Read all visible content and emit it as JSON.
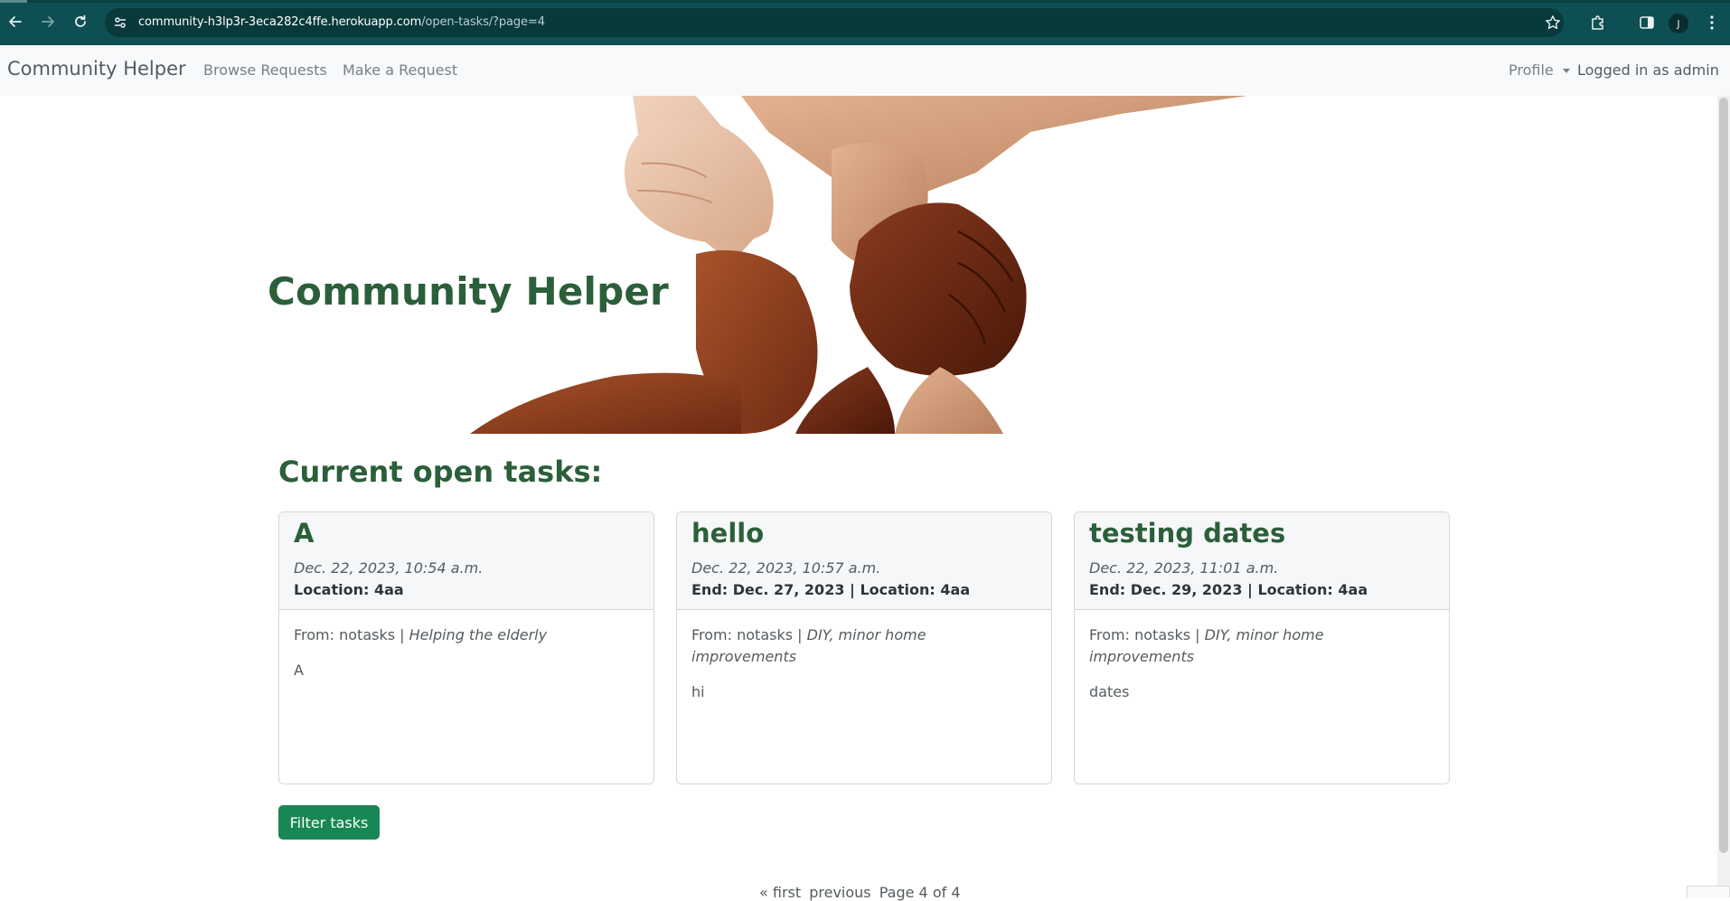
{
  "browser": {
    "url_host": "community-h3lp3r-3eca282c4ffe.herokuapp.com",
    "url_path": "/open-tasks/?page=4",
    "profile_initial": "J"
  },
  "navbar": {
    "brand": "Community Helper",
    "links": [
      "Browse Requests",
      "Make a Request"
    ],
    "profile": "Profile",
    "logged_in": "Logged in as admin"
  },
  "hero": {
    "title": "Community Helper",
    "image": "hands-holding-wrists"
  },
  "tasks_section": {
    "title": "Current open tasks:",
    "cards": [
      {
        "title": "A",
        "date": "Dec. 22, 2023, 10:54 a.m.",
        "location_line": "Location: 4aa",
        "from_prefix": "From: notasks | ",
        "category": "Helping the elderly",
        "description": "A"
      },
      {
        "title": "hello",
        "date": "Dec. 22, 2023, 10:57 a.m.",
        "location_line": "End: Dec. 27, 2023 | Location: 4aa",
        "from_prefix": "From: notasks | ",
        "category": "DIY, minor home improvements",
        "description": "hi"
      },
      {
        "title": "testing dates",
        "date": "Dec. 22, 2023, 11:01 a.m.",
        "location_line": "End: Dec. 29, 2023 | Location: 4aa",
        "from_prefix": "From: notasks | ",
        "category": "DIY, minor home improvements",
        "description": "dates"
      }
    ],
    "filter_button": "Filter tasks"
  },
  "pagination": {
    "first": "« first",
    "previous": "previous",
    "page_info": "Page 4 of 4"
  },
  "colors": {
    "chrome": "#0d4f52",
    "heading_green": "#2b5f3a",
    "button_green": "#198754",
    "navbar_bg": "#f8f9fa"
  }
}
